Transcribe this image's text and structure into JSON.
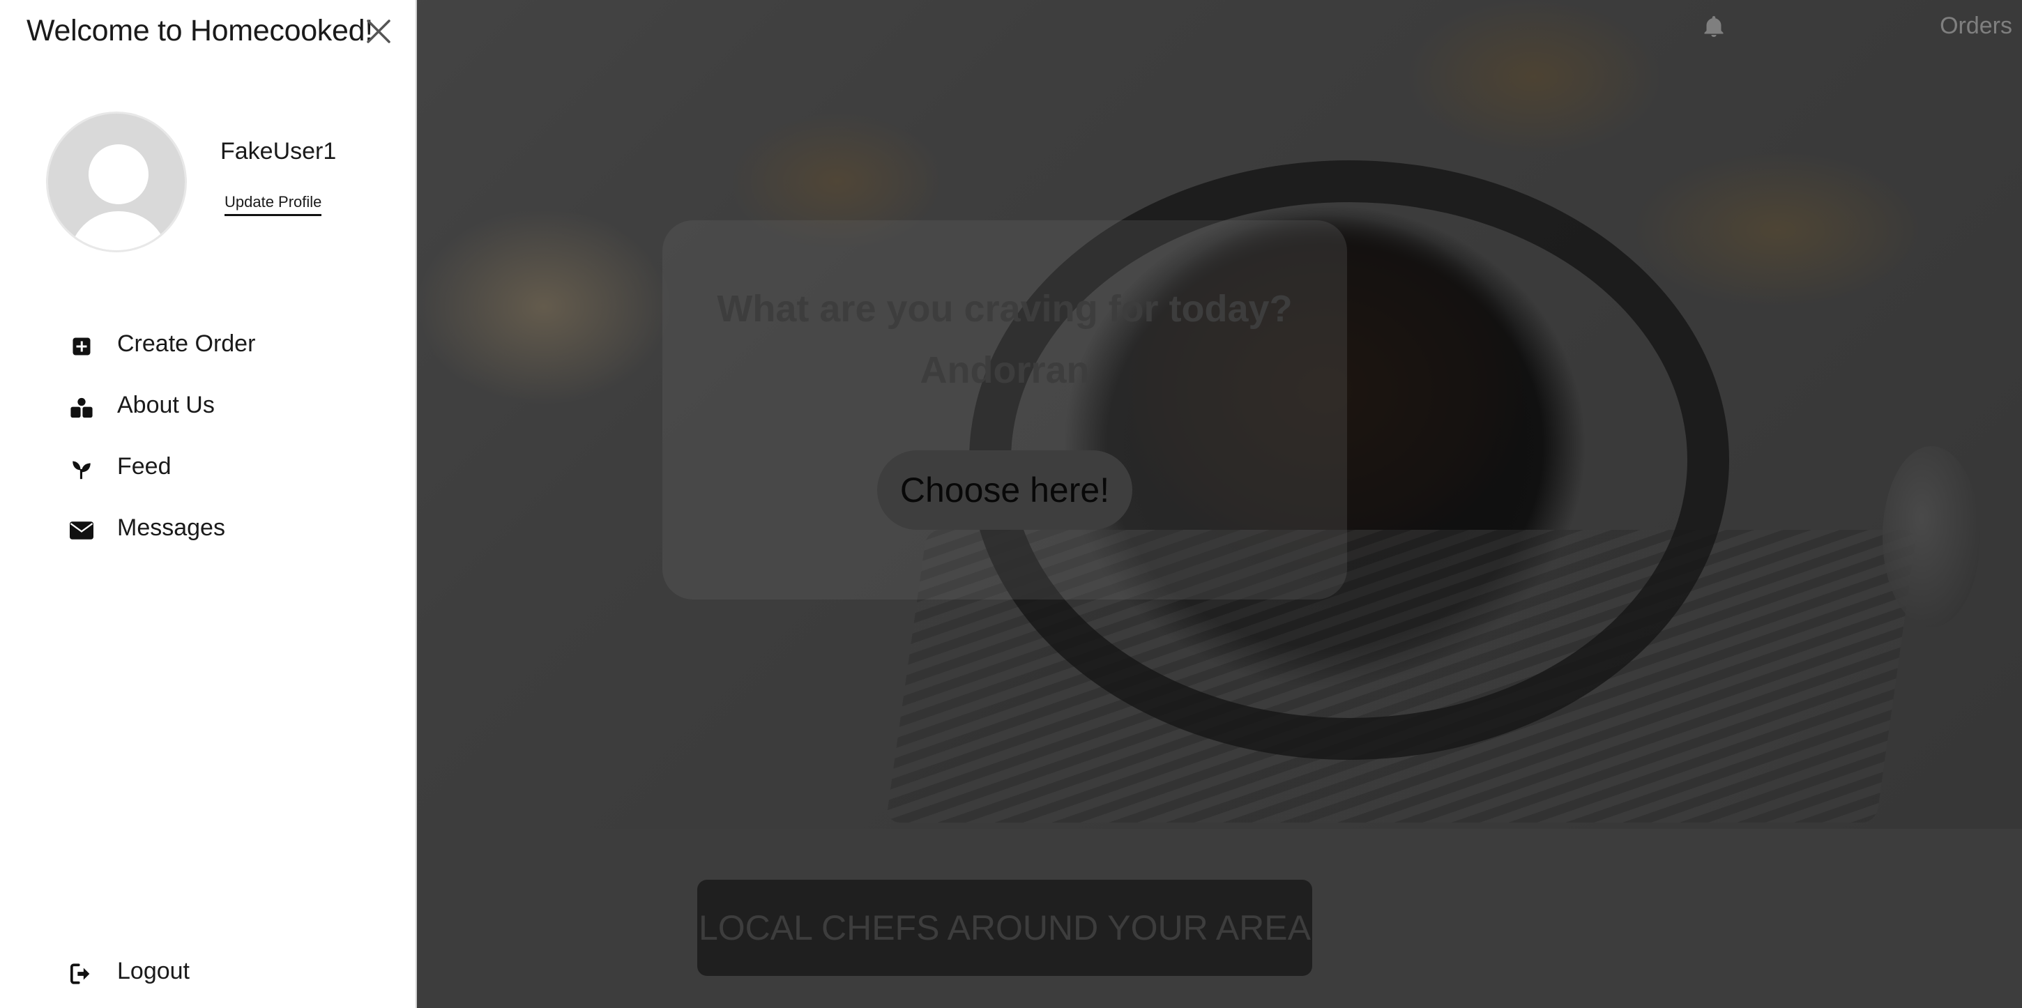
{
  "sidebar": {
    "title": "Welcome to Homecooked!",
    "username": "FakeUser1",
    "update_profile": "Update Profile",
    "menu": [
      {
        "label": "Create Order",
        "icon": "plus-square-icon"
      },
      {
        "label": "About Us",
        "icon": "users-icon"
      },
      {
        "label": "Feed",
        "icon": "seedling-icon"
      },
      {
        "label": "Messages",
        "icon": "envelope-icon"
      }
    ],
    "logout": {
      "label": "Logout",
      "icon": "logout-icon"
    }
  },
  "header": {
    "orders_label": "Orders",
    "bell_icon": "bell-icon"
  },
  "hero": {
    "title": "What are you craving for today?",
    "cuisine": "Andorran",
    "choose_label": "Choose here!"
  },
  "section": {
    "chefs_label": "LOCAL CHEFS AROUND YOUR AREA"
  }
}
